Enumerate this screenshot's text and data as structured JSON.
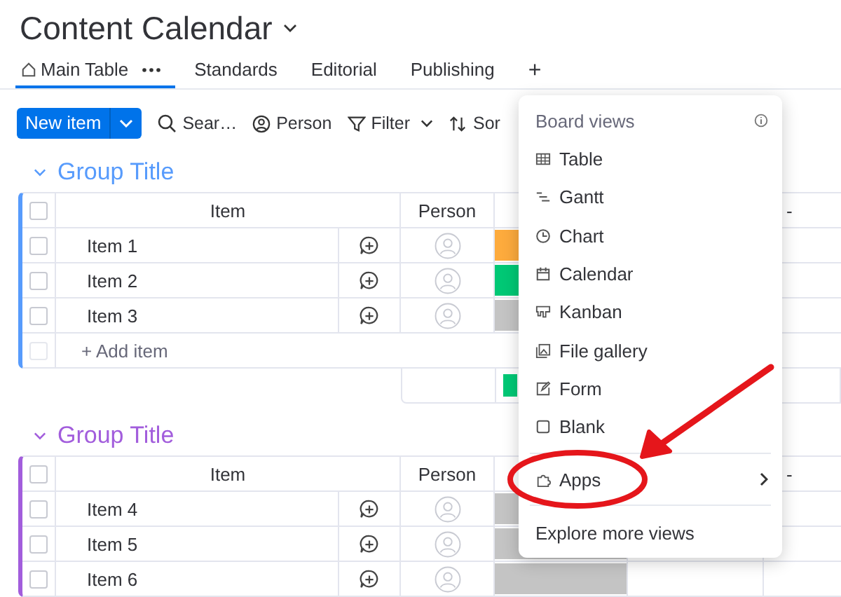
{
  "board": {
    "title": "Content Calendar"
  },
  "tabs": [
    {
      "label": "Main Table",
      "selected": true,
      "kind": "home"
    },
    {
      "label": "Standards",
      "selected": false
    },
    {
      "label": "Editorial",
      "selected": false
    },
    {
      "label": "Publishing",
      "selected": false
    }
  ],
  "add_tab": "+",
  "toolbar": {
    "new_item": "New item",
    "search": "Sear…",
    "person": "Person",
    "filter": "Filter",
    "sort": "Sor"
  },
  "groups": [
    {
      "title": "Group Title",
      "color": "#579bfc",
      "columns": [
        "Item",
        "Person",
        "-"
      ],
      "select_all_checked": false,
      "add_item": {
        "label": "+ Add item",
        "checked": false
      },
      "rows": [
        {
          "item": "Item 1",
          "checked": false,
          "color": "#fdab3d"
        },
        {
          "item": "Item 2",
          "checked": false,
          "color": "#00c875"
        },
        {
          "item": "Item 3",
          "checked": false,
          "color": "#c4c4c4"
        }
      ]
    },
    {
      "title": "Group Title",
      "color": "#a25ddc",
      "columns": [
        "Item",
        "Person",
        "-"
      ],
      "select_all_checked": false,
      "rows": [
        {
          "item": "Item 4",
          "checked": false,
          "color": "#c4c4c4"
        },
        {
          "item": "Item 5",
          "checked": false,
          "color": "#c4c4c4"
        },
        {
          "item": "Item 6",
          "checked": false,
          "color": "#c4c4c4"
        }
      ]
    }
  ],
  "menu": {
    "header": "Board views",
    "items": [
      {
        "label": "Table",
        "kind": "table"
      },
      {
        "label": "Gantt",
        "kind": "gantt"
      },
      {
        "label": "Chart",
        "kind": "chart"
      },
      {
        "label": "Calendar",
        "kind": "calendar"
      },
      {
        "label": "Kanban",
        "kind": "kanban"
      },
      {
        "label": "File gallery",
        "kind": "gallery"
      },
      {
        "label": "Form",
        "kind": "form"
      },
      {
        "label": "Blank",
        "kind": "blank"
      }
    ],
    "apps": "Apps",
    "footer": "Explore more views"
  }
}
